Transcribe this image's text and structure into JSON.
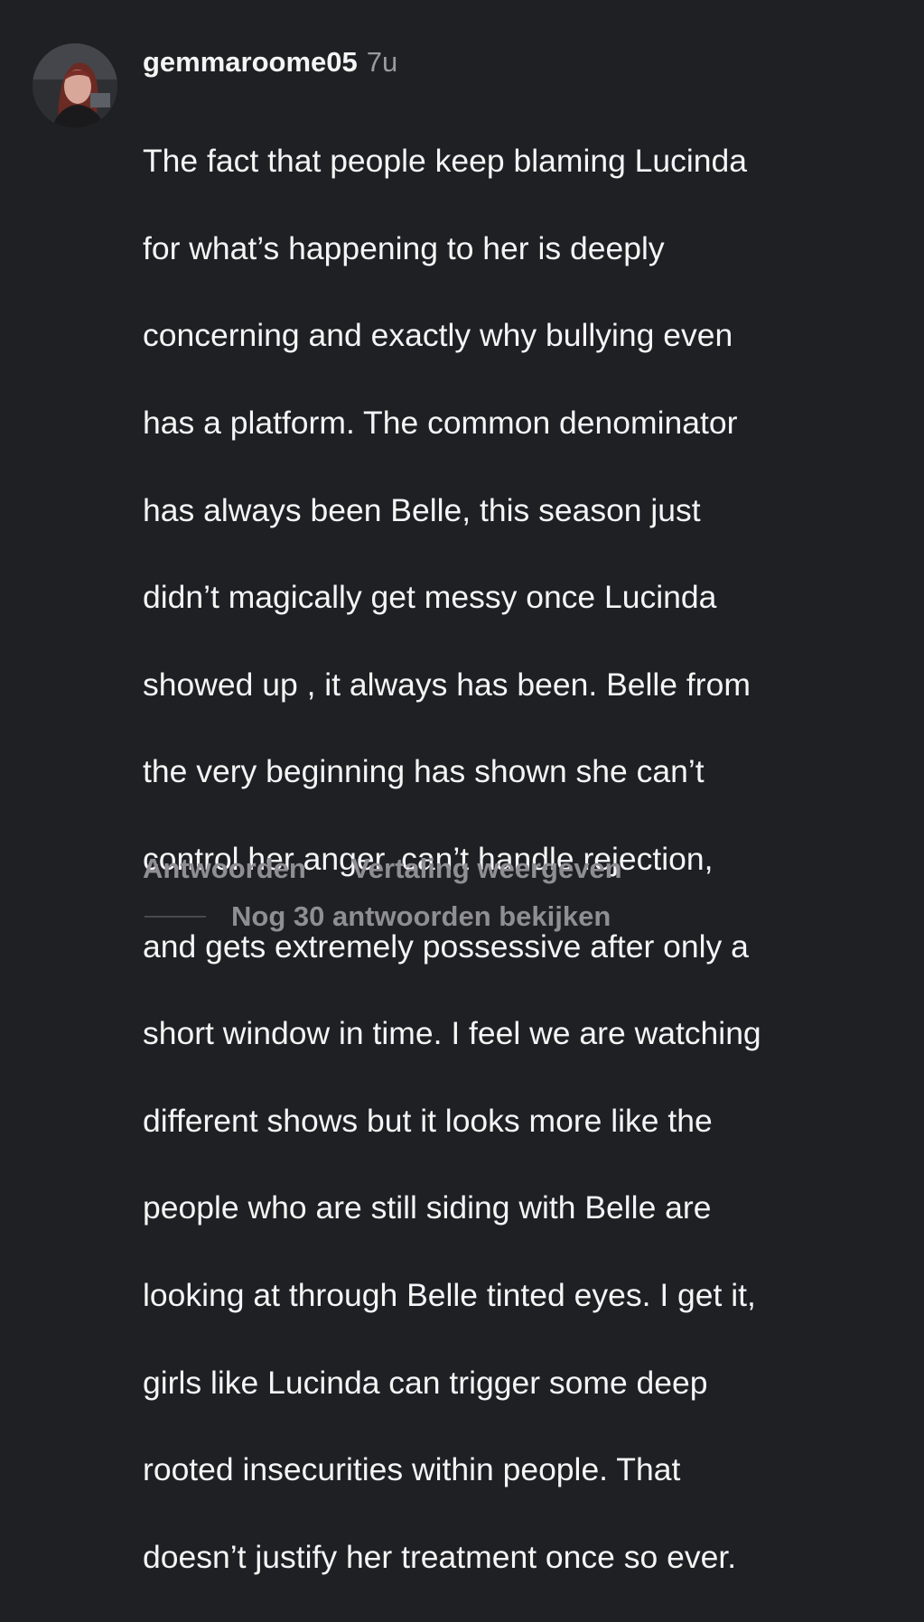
{
  "comment": {
    "avatar_icon": "profile-photo",
    "username": "gemmaroome05",
    "time": "7u",
    "text_lines": [
      "The fact that people keep blaming Lucinda",
      "for what’s happening to her is deeply",
      "concerning and exactly why bullying even",
      "has a platform. The common denominator",
      "has always been Belle, this season just",
      "didn’t magically get messy once Lucinda",
      "showed up , it always has been. Belle from",
      "the very beginning has shown she can’t",
      "control her anger, can’t handle rejection,",
      "and gets extremely possessive after only a",
      "short window in time. I feel we are watching",
      "different shows but it looks more like the",
      "people who are still siding with Belle are",
      "looking at through Belle tinted eyes. I get it,",
      "girls like Lucinda can trigger some deep",
      "rooted insecurities within people. That",
      "doesn’t justify her treatment once so ever."
    ],
    "reply_label": "Antwoorden",
    "translate_label": "Vertaling weergeven",
    "view_replies_label": "Nog 30 antwoorden bekijken"
  },
  "colors": {
    "background": "#1f2023",
    "text": "#f5f5f5",
    "muted": "#8e8e93"
  }
}
